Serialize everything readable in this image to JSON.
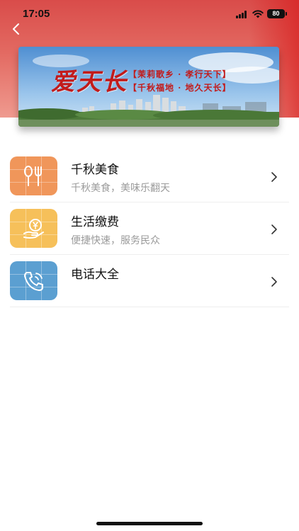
{
  "status_bar": {
    "time": "17:05",
    "battery": "80"
  },
  "banner": {
    "title": "爱天长",
    "line_1": "【茉莉歌乡 · 孝行天下】",
    "line_2": "【千秋福地 · 地久天长】"
  },
  "services": [
    {
      "title": "千秋美食",
      "subtitle": "千秋美食，美味乐翻天",
      "icon": "fork-spoon-icon",
      "color": "#f0965a"
    },
    {
      "title": "生活缴费",
      "subtitle": "便捷快速，服务民众",
      "icon": "yuan-hand-icon",
      "color": "#f6c05a"
    },
    {
      "title": "电话大全",
      "subtitle": "",
      "icon": "phone-icon",
      "color": "#5b9fd1"
    }
  ]
}
